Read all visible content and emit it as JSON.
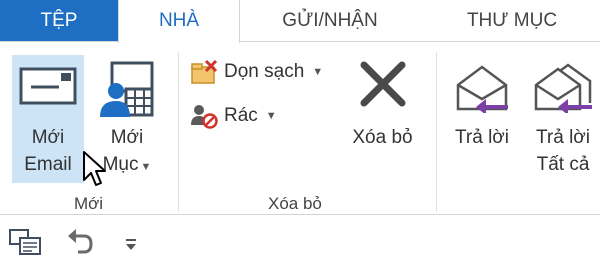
{
  "tabs": [
    {
      "label": "TỆP"
    },
    {
      "label": "NHÀ"
    },
    {
      "label": "GỬI/NHẬN"
    },
    {
      "label": "THƯ MỤC"
    }
  ],
  "groups": {
    "new": {
      "label": "Mới",
      "new_email": {
        "line1": "Mới",
        "line2": "Email"
      },
      "new_items": {
        "line1": "Mới",
        "line2": "Mục"
      }
    },
    "delete": {
      "label": "Xóa bỏ",
      "clean_up": "Dọn sạch",
      "junk": "Rác",
      "delete": "Xóa bỏ"
    },
    "respond": {
      "reply": {
        "line1": "Trả lời"
      },
      "reply_all": {
        "line1": "Trả lời",
        "line2": "Tất cả"
      }
    }
  },
  "colors": {
    "accent": "#1e6fc3",
    "selected_button": "#cde4f7",
    "reply_arrow": "#7b3fa6"
  },
  "icons": {
    "new_email": "envelope-icon",
    "new_items": "contact-calendar-icon",
    "clean_up": "folder-clean-icon",
    "junk": "junk-person-icon",
    "delete": "x-icon",
    "reply": "reply-envelope-icon",
    "reply_all": "reply-all-envelope-icon",
    "qat_send_receive": "send-receive-icon",
    "qat_undo": "undo-icon",
    "qat_customize": "customize-qat-icon"
  }
}
